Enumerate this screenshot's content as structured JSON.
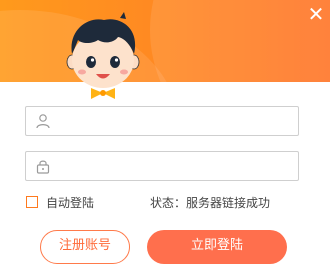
{
  "window": {
    "close_glyph": "✕"
  },
  "colors": {
    "header_start": "#ff9a1c",
    "header_end": "#ff7426",
    "accent": "#ff6f4d"
  },
  "login": {
    "username": {
      "value": "",
      "placeholder": "",
      "icon": "user-icon"
    },
    "password": {
      "value": "",
      "placeholder": "",
      "icon": "lock-icon"
    },
    "remember_label": "自动登陆",
    "remember_checked": false,
    "status": "状态：服务器链接成功",
    "register_label": "注册账号",
    "login_label": "立即登陆"
  }
}
